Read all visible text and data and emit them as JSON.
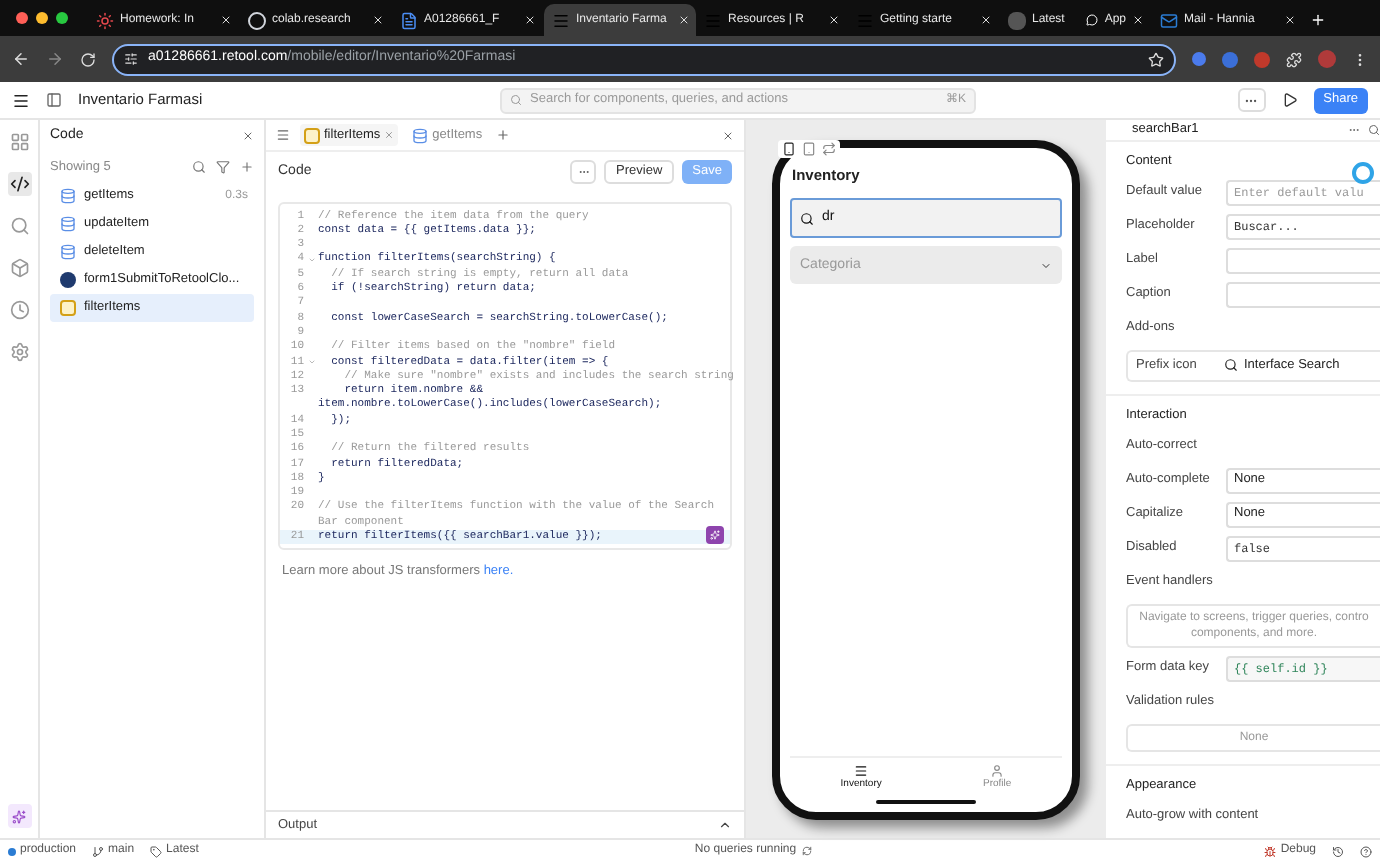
{
  "browser": {
    "tabs": [
      {
        "title": "Homework: In",
        "kind": "ring",
        "selected": false
      },
      {
        "title": "colab.research",
        "kind": "colab",
        "selected": false
      },
      {
        "title": "A01286661_F",
        "kind": "doc",
        "selected": false
      },
      {
        "title": "Inventario Farma",
        "kind": "retool",
        "selected": true
      },
      {
        "title": "Resources | R",
        "kind": "retool",
        "selected": false
      },
      {
        "title": "Getting starte",
        "kind": "retool",
        "selected": false
      },
      {
        "title": "Latest",
        "title_tail": "App",
        "kind": "dark",
        "selected": false
      },
      {
        "title": "Mail - Hannia",
        "kind": "mail",
        "selected": false
      }
    ],
    "url_host": "a01286661.retool.com",
    "url_path": "/mobile/editor/Inventario%20Farmasi"
  },
  "header": {
    "app_name": "Inventario Farmasi",
    "search_placeholder": "Search for components, queries, and actions",
    "shortcut": "⌘K",
    "share": "Share"
  },
  "rail": [
    {
      "kind": "components",
      "selected": false
    },
    {
      "kind": "code",
      "selected": true
    },
    {
      "kind": "search",
      "selected": false
    },
    {
      "kind": "state",
      "selected": false
    },
    {
      "kind": "history",
      "selected": false
    },
    {
      "kind": "settings",
      "selected": false
    }
  ],
  "code_list": {
    "title": "Code",
    "count": "Showing 5",
    "items": [
      {
        "name": "getItems",
        "kind": "query",
        "time": "0.3s",
        "selected": false
      },
      {
        "name": "updateItem",
        "kind": "query",
        "selected": false
      },
      {
        "name": "deleteItem",
        "kind": "query",
        "selected": false
      },
      {
        "name": "form1SubmitToRetoolClo...",
        "kind": "retooldb",
        "selected": false
      },
      {
        "name": "filterItems",
        "kind": "transformer",
        "selected": true
      }
    ]
  },
  "editor": {
    "tabs": [
      {
        "label": "filterItems",
        "kind": "transformer",
        "selected": true
      },
      {
        "label": "getItems",
        "kind": "query",
        "selected": false
      }
    ],
    "title": "Code",
    "preview": "Preview",
    "save": "Save",
    "lines": [
      {
        "number": "1",
        "kind": "comment",
        "text": "// Reference the item data from the query"
      },
      {
        "number": "2",
        "kind": "code",
        "text": "const data = {{ getItems.data }};"
      },
      {
        "number": "3"
      },
      {
        "number": "4",
        "kind": "code",
        "fold": true,
        "text": "function filterItems(searchString) {"
      },
      {
        "number": "5",
        "kind": "comment",
        "text": "  // If search string is empty, return all data"
      },
      {
        "number": "6",
        "kind": "code",
        "text": "  if (!searchString) return data;"
      },
      {
        "number": "7"
      },
      {
        "number": "8",
        "kind": "code",
        "text": "  const lowerCaseSearch = searchString.toLowerCase();"
      },
      {
        "number": "9"
      },
      {
        "number": "10",
        "kind": "comment",
        "text": "  // Filter items based on the \"nombre\" field"
      },
      {
        "number": "11",
        "kind": "code",
        "fold": true,
        "text": "  const filteredData = data.filter(item => {"
      },
      {
        "number": "12",
        "kind": "comment",
        "text": "    // Make sure \"nombre\" exists and includes the search string"
      },
      {
        "number": "13",
        "kind": "code",
        "text": "    return item.nombre &&"
      },
      {
        "kind": "code",
        "text": "item.nombre.toLowerCase().includes(lowerCaseSearch);"
      },
      {
        "number": "14",
        "kind": "code",
        "text": "  });"
      },
      {
        "number": "15"
      },
      {
        "number": "16",
        "kind": "comment",
        "text": "  // Return the filtered results"
      },
      {
        "number": "17",
        "kind": "code",
        "text": "  return filteredData;"
      },
      {
        "number": "18",
        "kind": "code",
        "text": "}"
      },
      {
        "number": "19"
      },
      {
        "number": "20",
        "kind": "comment",
        "text": "// Use the filterItems function with the value of the Search"
      },
      {
        "kind": "comment",
        "text": "Bar component"
      },
      {
        "number": "21",
        "kind": "code",
        "active": true,
        "text": "return filterItems({{ searchBar1.value }});"
      }
    ],
    "learn_more": "Learn more about JS transformers",
    "link": "here.",
    "output": "Output"
  },
  "canvas": {
    "title": "Inventory",
    "search_value": "dr",
    "select_placeholder": "Categoria",
    "nav": [
      {
        "label": "Inventory",
        "kind": "menu",
        "selected": true
      },
      {
        "label": "Profile",
        "kind": "person",
        "selected": false
      }
    ]
  },
  "inspector": {
    "title": "searchBar1",
    "sections": [
      {
        "title": "Content",
        "rows": [
          {
            "kind": "field",
            "label": "Default value",
            "placeholder": "Enter default valu"
          },
          {
            "kind": "field",
            "label": "Placeholder",
            "value": "Buscar..."
          },
          {
            "kind": "field",
            "label": "Label"
          },
          {
            "kind": "field",
            "label": "Caption"
          },
          {
            "kind": "heading",
            "label": "Add-ons"
          },
          {
            "kind": "addon",
            "label": "Prefix icon",
            "value": "Interface Search"
          }
        ]
      },
      {
        "title": "Interaction",
        "rows": [
          {
            "kind": "heading",
            "label": "Auto-correct"
          },
          {
            "kind": "select",
            "label": "Auto-complete",
            "value": "None"
          },
          {
            "kind": "select",
            "label": "Capitalize",
            "value": "None"
          },
          {
            "kind": "field",
            "label": "Disabled",
            "value": "false"
          },
          {
            "kind": "heading",
            "label": "Event handlers"
          },
          {
            "kind": "note",
            "value": "Navigate to screens, trigger queries, contro components, and more."
          },
          {
            "kind": "code",
            "label": "Form data key",
            "value": "{{ self.id }}"
          },
          {
            "kind": "heading",
            "label": "Validation rules"
          },
          {
            "kind": "note",
            "value": "None"
          }
        ]
      },
      {
        "title": "Appearance",
        "rows": [
          {
            "kind": "heading",
            "label": "Auto-grow with content"
          }
        ]
      }
    ]
  },
  "status": {
    "env": "production",
    "branch": "main",
    "release": "Latest",
    "queries": "No queries running",
    "debug": "Debug"
  }
}
